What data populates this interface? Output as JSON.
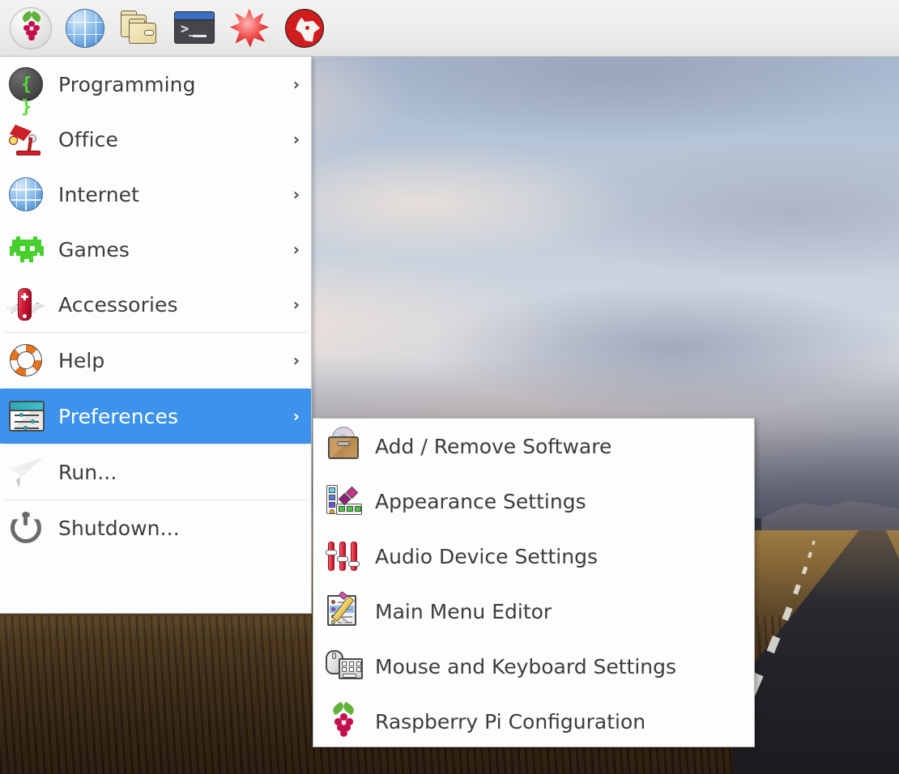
{
  "taskbar": {
    "items": [
      {
        "label": "Menu",
        "icon": "raspberry-pi-icon"
      },
      {
        "label": "Web Browser",
        "icon": "globe-icon"
      },
      {
        "label": "File Manager",
        "icon": "folder-icon"
      },
      {
        "label": "Terminal",
        "icon": "terminal-icon"
      },
      {
        "label": "Mathematica",
        "icon": "starburst-icon"
      },
      {
        "label": "Wolfram",
        "icon": "wolf-icon"
      }
    ]
  },
  "main_menu": {
    "items": [
      {
        "label": "Programming",
        "icon": "code-braces-icon",
        "has_submenu": true,
        "selected": false,
        "separator_after": false
      },
      {
        "label": "Office",
        "icon": "desk-lamp-icon",
        "has_submenu": true,
        "selected": false,
        "separator_after": false
      },
      {
        "label": "Internet",
        "icon": "globe-icon",
        "has_submenu": true,
        "selected": false,
        "separator_after": false
      },
      {
        "label": "Games",
        "icon": "space-invader-icon",
        "has_submenu": true,
        "selected": false,
        "separator_after": false
      },
      {
        "label": "Accessories",
        "icon": "swiss-knife-icon",
        "has_submenu": true,
        "selected": false,
        "separator_after": true
      },
      {
        "label": "Help",
        "icon": "life-ring-icon",
        "has_submenu": true,
        "selected": false,
        "separator_after": true
      },
      {
        "label": "Preferences",
        "icon": "preferences-icon",
        "has_submenu": true,
        "selected": true,
        "separator_after": true
      },
      {
        "label": "Run...",
        "icon": "paper-plane-icon",
        "has_submenu": false,
        "selected": false,
        "separator_after": true
      },
      {
        "label": "Shutdown...",
        "icon": "power-icon",
        "has_submenu": false,
        "selected": false,
        "separator_after": false
      }
    ],
    "submenu_arrow": "›"
  },
  "submenu": {
    "title": "Preferences",
    "items": [
      {
        "label": "Add / Remove Software",
        "icon": "software-box-icon"
      },
      {
        "label": "Appearance Settings",
        "icon": "color-swatches-icon"
      },
      {
        "label": "Audio Device Settings",
        "icon": "audio-sliders-icon"
      },
      {
        "label": "Main Menu Editor",
        "icon": "menu-editor-icon"
      },
      {
        "label": "Mouse and Keyboard Settings",
        "icon": "mouse-keyboard-icon"
      },
      {
        "label": "Raspberry Pi Configuration",
        "icon": "raspberry-pi-icon"
      }
    ]
  },
  "colors": {
    "highlight": "#3d93ec",
    "menu_background": "#fdfdfd",
    "menu_text": "#3c3c3c",
    "highlight_text": "#ffffff",
    "taskbar_background": "#ececea",
    "separator": "#e4e4e4"
  },
  "desktop": {
    "wallpaper_description": "Empty asphalt road at sunset with clouds, golden fields and distant mountains"
  }
}
